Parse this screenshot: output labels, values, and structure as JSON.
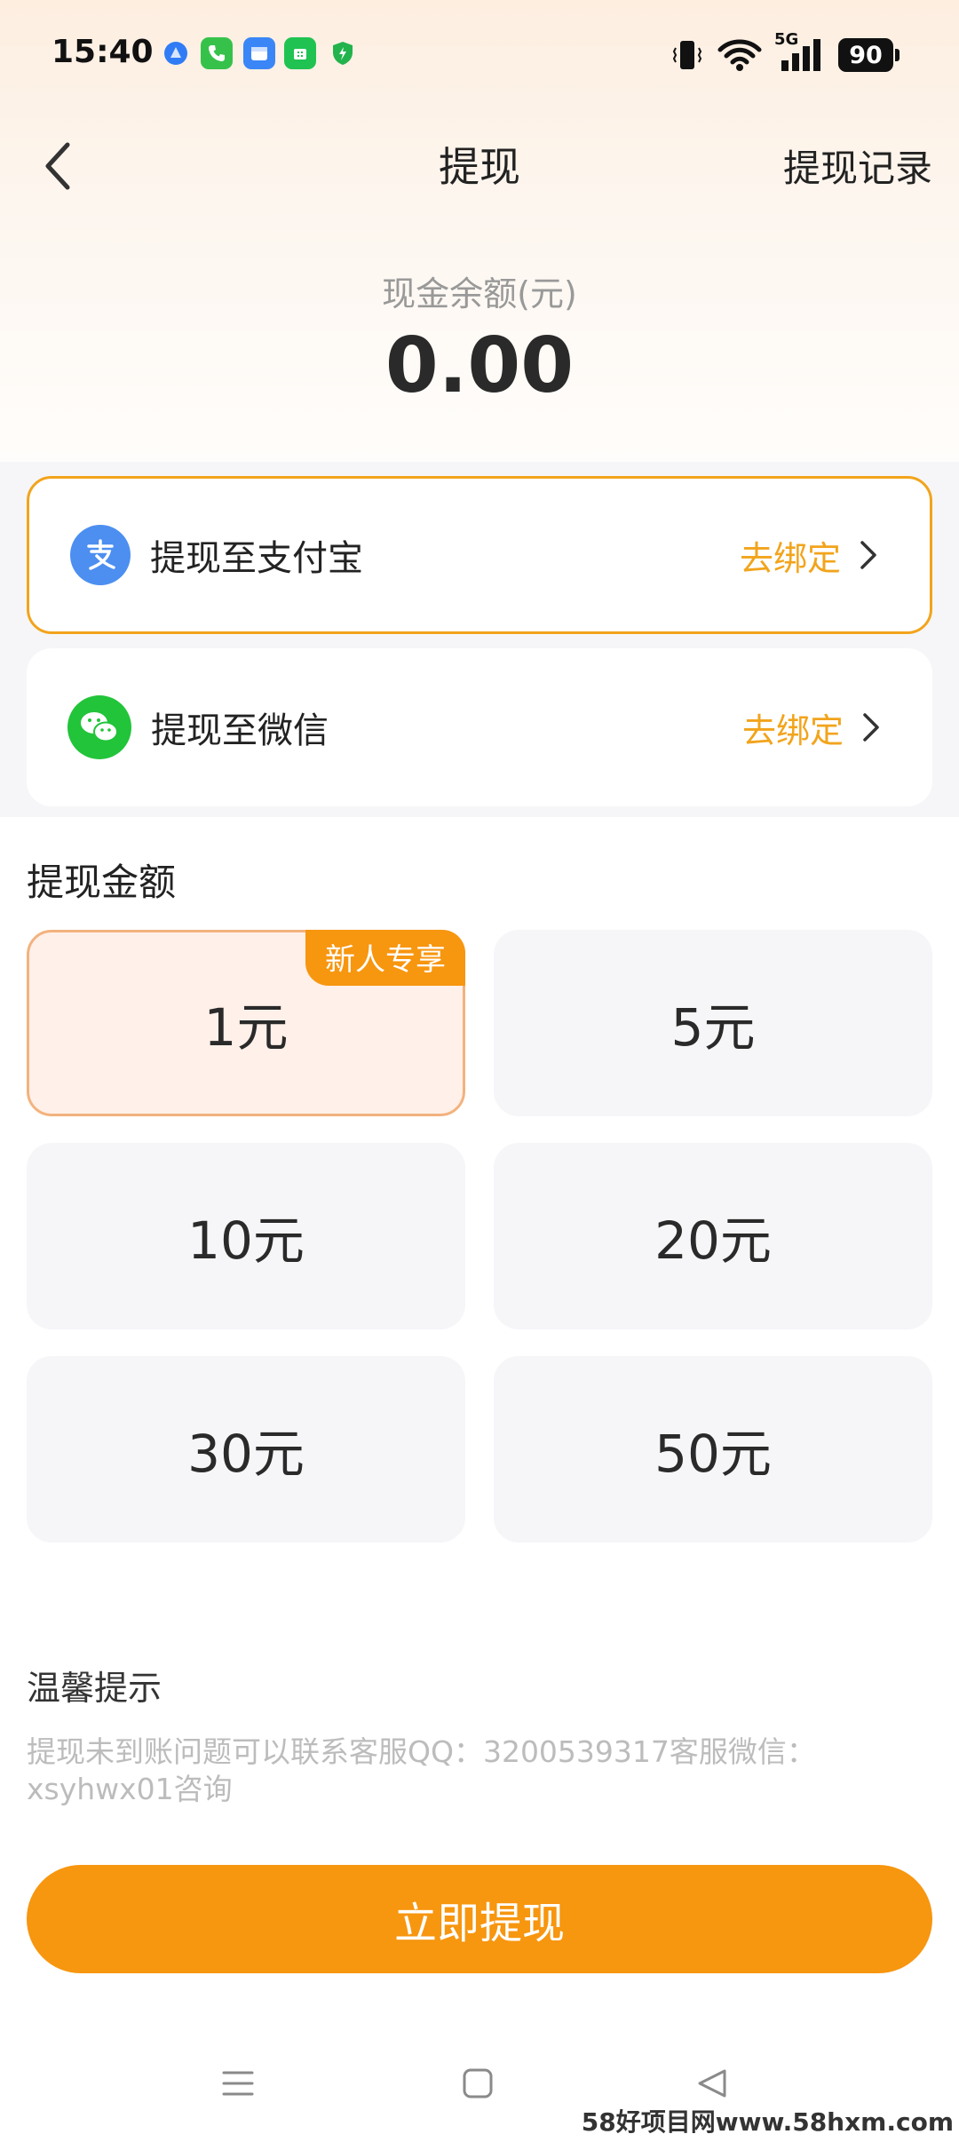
{
  "status_bar": {
    "time": "15:40",
    "network": "5G",
    "battery": "90",
    "notification_icons": [
      "browser-icon",
      "phone-icon",
      "calendar-icon",
      "app-icon",
      "shield-icon"
    ]
  },
  "header": {
    "title": "提现",
    "records_label": "提现记录"
  },
  "balance": {
    "label": "现金余额(元)",
    "value": "0.00"
  },
  "payment_methods": [
    {
      "label": "提现至支付宝",
      "action": "去绑定",
      "icon": "alipay-icon",
      "selected": true
    },
    {
      "label": "提现至微信",
      "action": "去绑定",
      "icon": "wechat-icon",
      "selected": false
    }
  ],
  "amount_section": {
    "title": "提现金额",
    "options": [
      {
        "label": "1元",
        "badge": "新人专享",
        "selected": true
      },
      {
        "label": "5元"
      },
      {
        "label": "10元"
      },
      {
        "label": "20元"
      },
      {
        "label": "30元"
      },
      {
        "label": "50元"
      }
    ]
  },
  "tips": {
    "title": "温馨提示",
    "text": "提现未到账问题可以联系客服QQ：3200539317客服微信：xsyhwx01咨询"
  },
  "submit_label": "立即提现",
  "watermark": "58好项目网www.58hxm.com",
  "colors": {
    "accent": "#f7960f",
    "bind_text": "#f2a41c",
    "alipay": "#4c8ff0",
    "wechat": "#22c43a"
  }
}
